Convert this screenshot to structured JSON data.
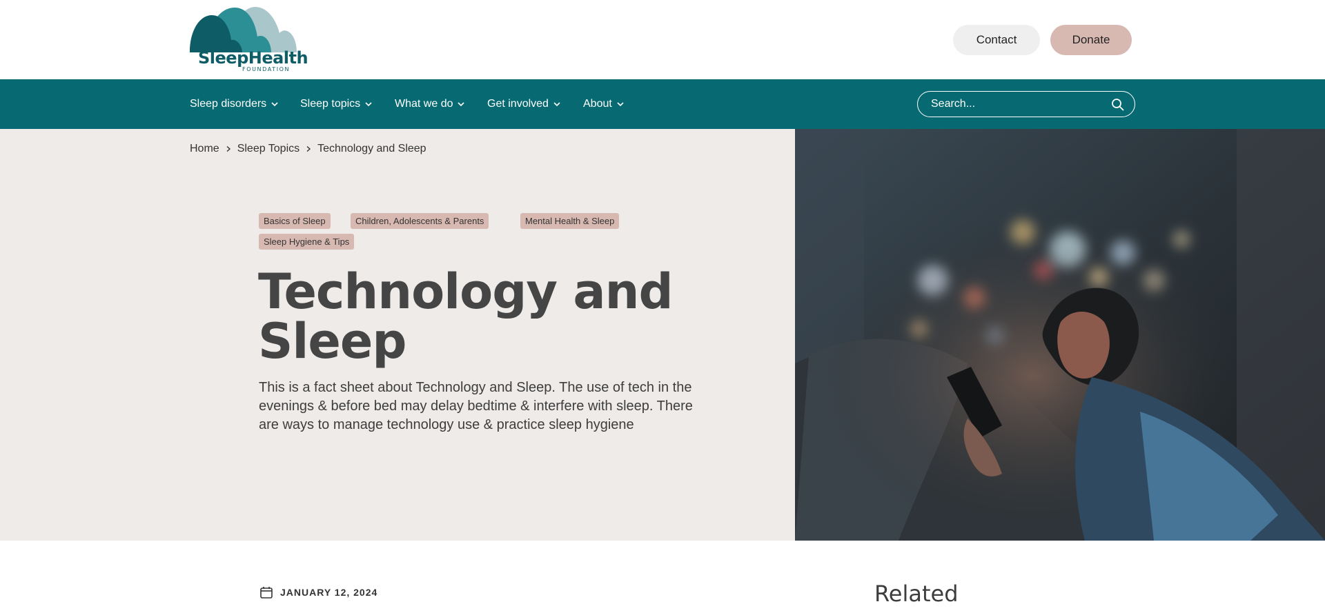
{
  "brand": {
    "logo_text": "SleepHealth",
    "logo_subtext": "FOUNDATION",
    "colors": {
      "teal_dark": "#076a72",
      "teal_mid": "#2c8f95",
      "teal_light": "#a9c7cb",
      "rose": "#d8b9b2",
      "hero_bg": "#efebe8"
    }
  },
  "header": {
    "contact_label": "Contact",
    "donate_label": "Donate"
  },
  "nav": {
    "items": [
      {
        "label": "Sleep disorders",
        "icon": "chevron-down-icon"
      },
      {
        "label": "Sleep topics",
        "icon": "chevron-down-icon"
      },
      {
        "label": "What we do",
        "icon": "chevron-down-icon"
      },
      {
        "label": "Get involved",
        "icon": "chevron-down-icon"
      },
      {
        "label": "About",
        "icon": "chevron-down-icon"
      }
    ],
    "search": {
      "placeholder": "Search...",
      "icon": "search-icon"
    }
  },
  "breadcrumb": {
    "items": [
      "Home",
      "Sleep Topics",
      "Technology and Sleep"
    ],
    "separator_icon": "chevron-right-icon"
  },
  "article": {
    "tags": [
      "Basics of Sleep",
      "Children, Adolescents & Parents",
      "Mental Health & Sleep",
      "Sleep Hygiene & Tips"
    ],
    "title": "Technology and Sleep",
    "description": "This is a fact sheet about Technology and Sleep. The use of tech in the evenings & before bed may delay bedtime & interfere with sleep. There are ways to manage technology use & practice sleep hygiene",
    "date": "JANUARY 12, 2024",
    "date_icon": "calendar-icon"
  },
  "sidebar": {
    "related_heading": "Related"
  }
}
